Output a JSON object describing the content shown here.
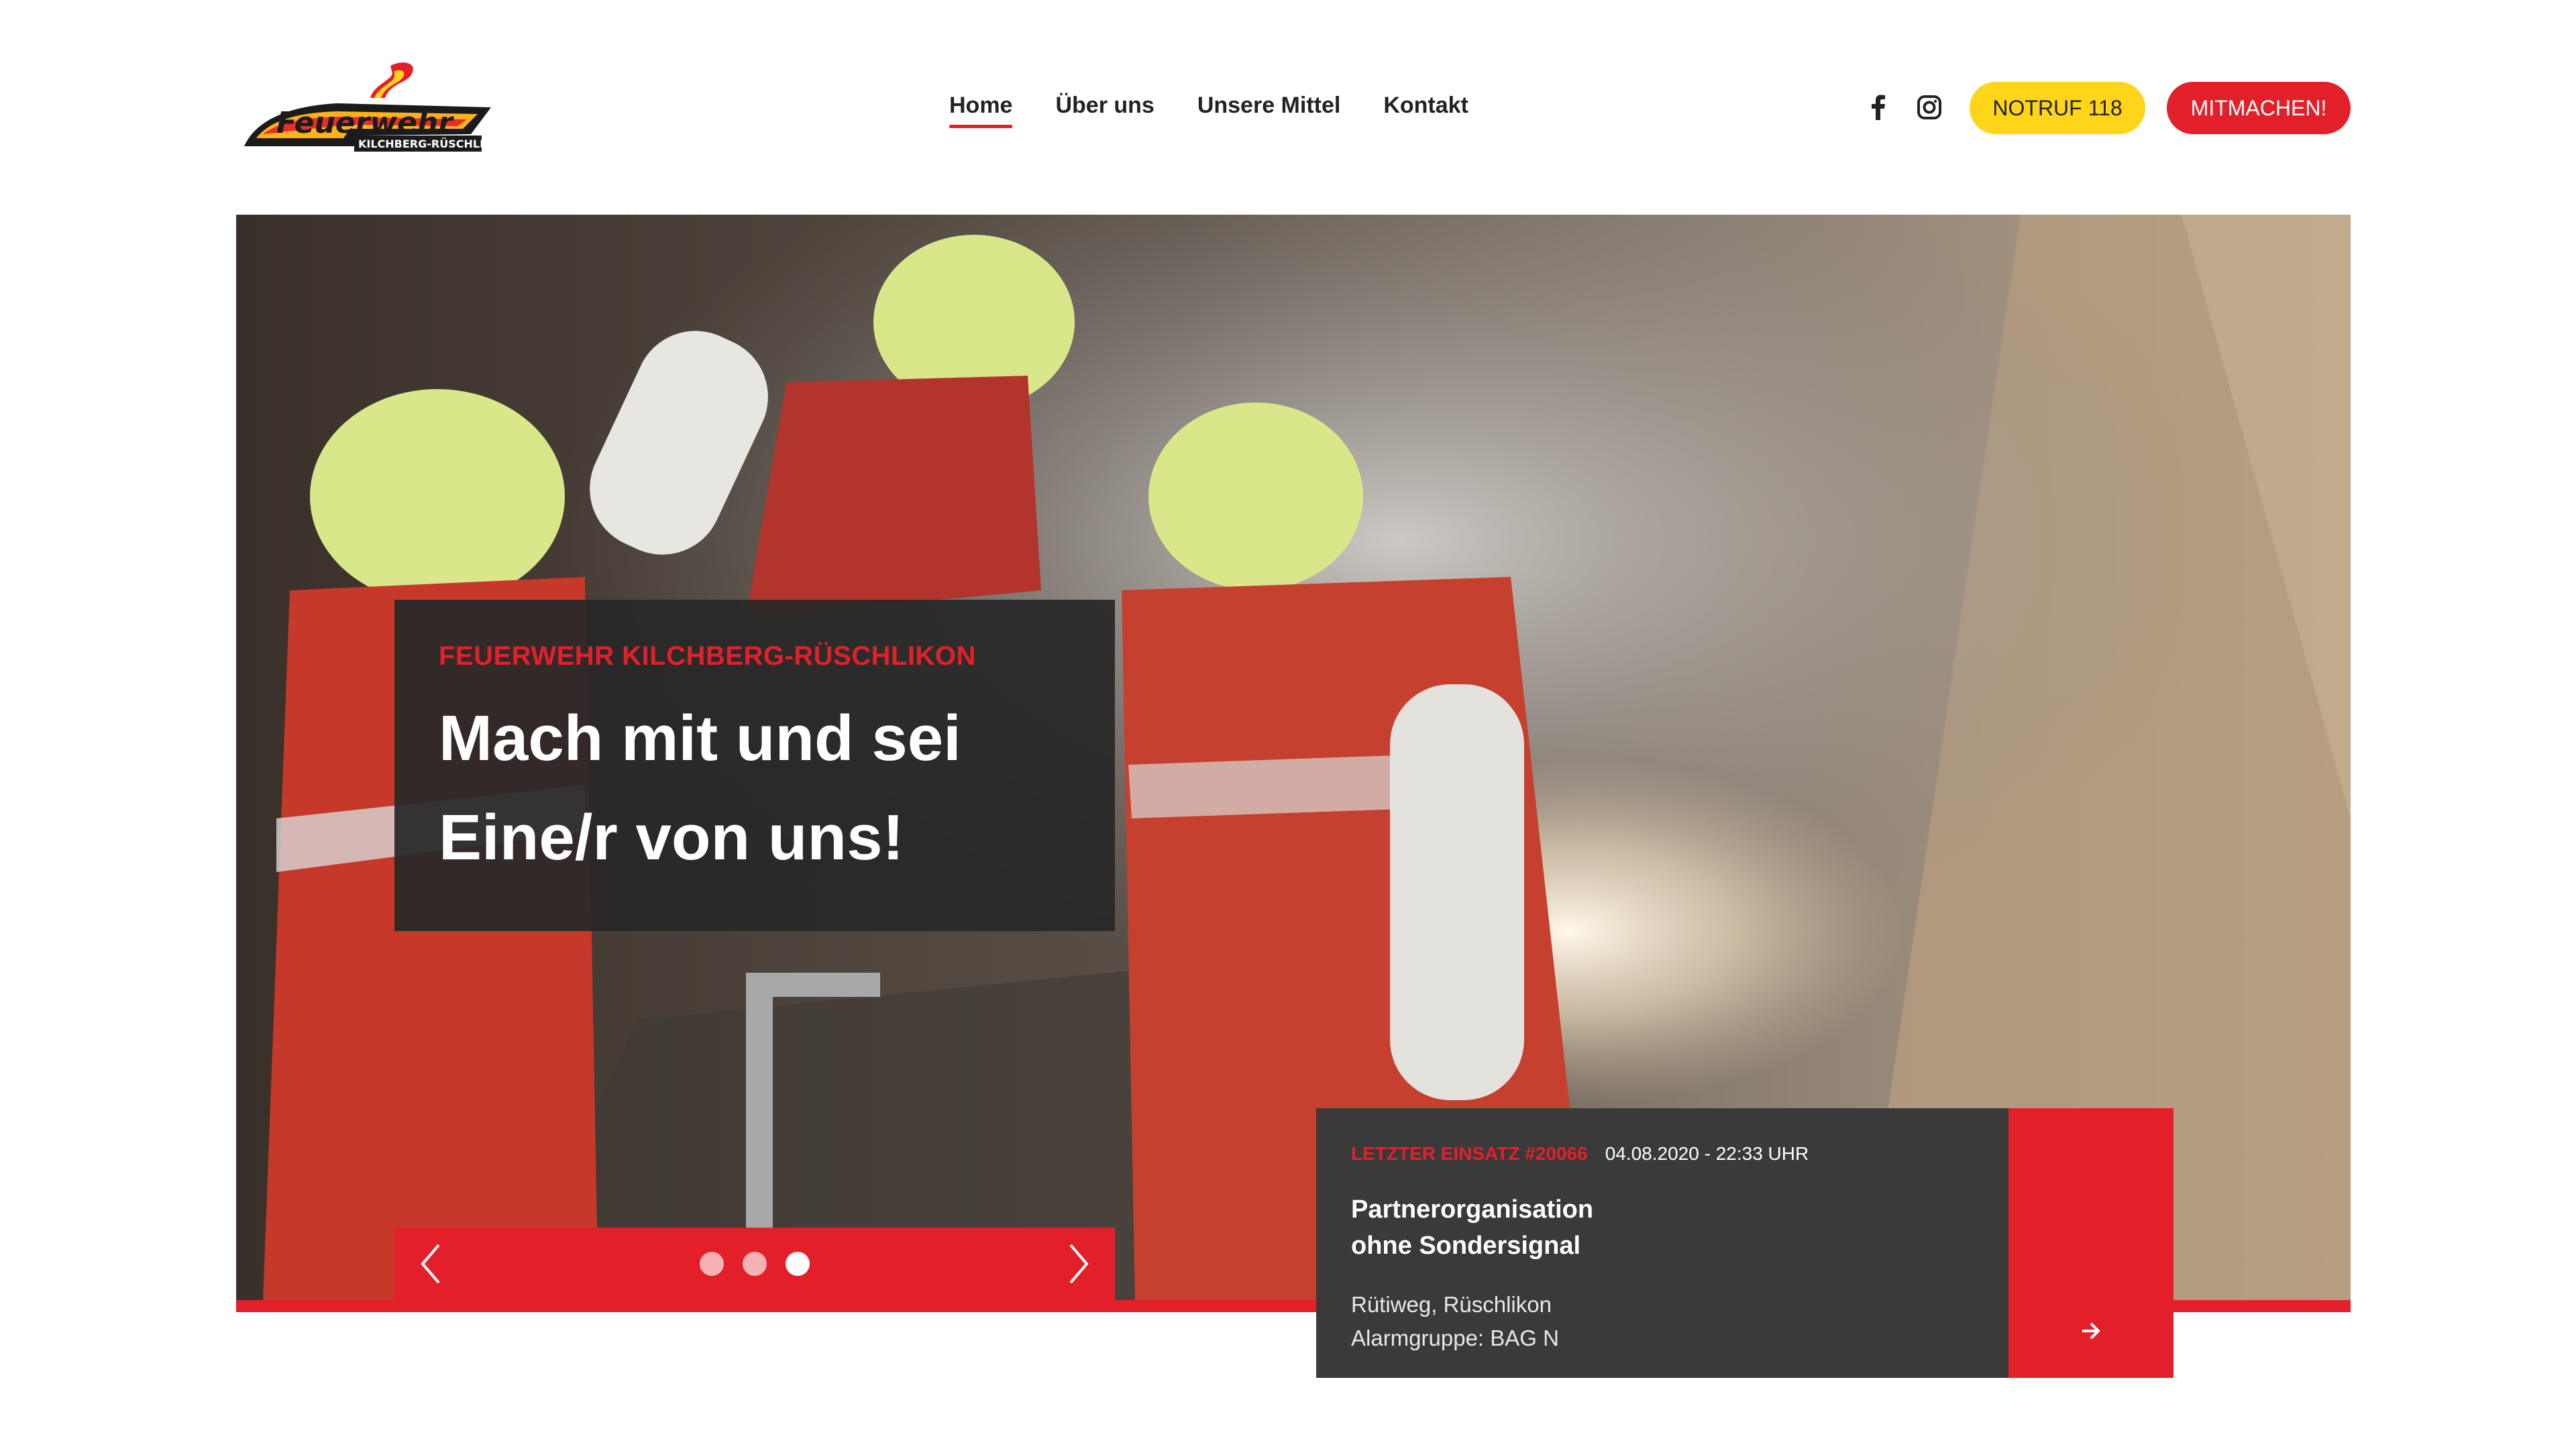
{
  "logo": {
    "wordmark": "Feuerwehr",
    "subtitle": "KILCHBERG-RÜSCHLIKON"
  },
  "nav": {
    "items": [
      {
        "label": "Home",
        "active": true
      },
      {
        "label": "Über uns",
        "active": false
      },
      {
        "label": "Unsere Mittel",
        "active": false
      },
      {
        "label": "Kontakt",
        "active": false
      }
    ]
  },
  "social": {
    "icons": [
      "facebook-icon",
      "instagram-icon"
    ]
  },
  "buttons": {
    "notruf": "NOTRUF 118",
    "mitmachen": "MITMACHEN!"
  },
  "hero": {
    "eyebrow": "FEUERWEHR KILCHBERG-RÜSCHLIKON",
    "title_line1": "Mach mit und sei",
    "title_line2": "Eine/r von uns!",
    "slider": {
      "slides": 3,
      "active_index": 2
    }
  },
  "einsatz": {
    "label": "LETZTER EINSATZ #20066",
    "datetime": "04.08.2020 - 22:33 UHR",
    "title_line1": "Partnerorganisation",
    "title_line2": "ohne Sondersignal",
    "location": "Rütiweg, Rüschlikon",
    "alarm_group": "Alarmgruppe: BAG N"
  },
  "colors": {
    "accent_red": "#e3202a",
    "accent_yellow": "#ffd51a",
    "card_dark": "#282828"
  }
}
